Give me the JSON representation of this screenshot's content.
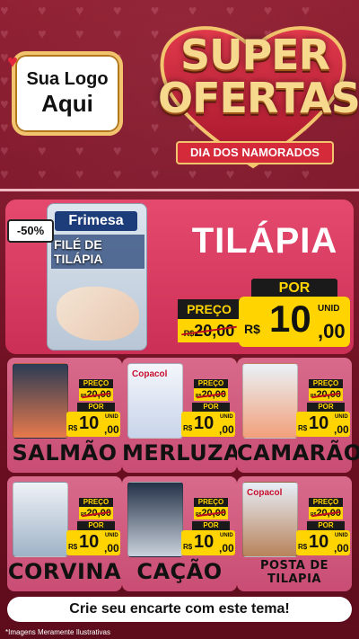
{
  "header": {
    "logo_line1": "Sua Logo",
    "logo_line2": "Aqui",
    "title_line1": "SUPER",
    "title_line2": "OFERTAS",
    "subtitle": "DIA DOS NAMORADOS"
  },
  "hero": {
    "discount": "-50%",
    "brand": "Frimesa",
    "pack_title": "FILÉ DE TILÁPIA",
    "name": "TILÁPIA",
    "preco_label": "PREÇO",
    "old_currency": "R$",
    "old_price": "20,00",
    "por_label": "POR",
    "currency": "R$",
    "price_int": "10",
    "price_cents": ",00",
    "unit": "UNID"
  },
  "cards": [
    {
      "name": "SALMÃO",
      "preco_label": "PREÇO",
      "old_currency": "R$",
      "old_price": "20,00",
      "por_label": "POR",
      "currency": "R$",
      "price_int": "10",
      "price_cents": ",00",
      "unit": "UNID",
      "img_color_top": "#2b3b55",
      "img_color_bottom": "#e87a4c"
    },
    {
      "name": "MERLUZA",
      "preco_label": "PREÇO",
      "old_currency": "R$",
      "old_price": "20,00",
      "por_label": "POR",
      "currency": "R$",
      "price_int": "10",
      "price_cents": ",00",
      "unit": "UNID",
      "img_color_top": "#f4f6fb",
      "img_color_bottom": "#c8d4ea",
      "brand": "Copacol"
    },
    {
      "name": "CAMARÃO",
      "preco_label": "PREÇO",
      "old_currency": "R$",
      "old_price": "20,00",
      "por_label": "POR",
      "currency": "R$",
      "price_int": "10",
      "price_cents": ",00",
      "unit": "UNID",
      "img_color_top": "#e9f1f7",
      "img_color_bottom": "#f2a07a"
    },
    {
      "name": "CORVINA",
      "preco_label": "PREÇO",
      "old_currency": "R$",
      "old_price": "20,00",
      "por_label": "POR",
      "currency": "R$",
      "price_int": "10",
      "price_cents": ",00",
      "unit": "UNID",
      "img_color_top": "#eef2f6",
      "img_color_bottom": "#9fb3c7"
    },
    {
      "name": "CAÇÃO",
      "preco_label": "PREÇO",
      "old_currency": "R$",
      "old_price": "20,00",
      "por_label": "POR",
      "currency": "R$",
      "price_int": "10",
      "price_cents": ",00",
      "unit": "UNID",
      "img_color_top": "#243248",
      "img_color_bottom": "#c9d2dc"
    },
    {
      "name": "POSTA DE TILAPIA",
      "preco_label": "PREÇO",
      "old_currency": "R$",
      "old_price": "20,00",
      "por_label": "POR",
      "currency": "R$",
      "price_int": "10",
      "price_cents": ",00",
      "unit": "UNID",
      "img_color_top": "#e7eef8",
      "img_color_bottom": "#b8835a",
      "brand": "Copacol"
    }
  ],
  "cta": "Crie seu encarte com este tema!",
  "disclaimer": "*Imagens Meramente Ilustrativas",
  "colors": {
    "background": "#7a1426",
    "hero_card": "#d63a60",
    "grid_card": "#cf5a7e",
    "price_yellow": "#ffd400",
    "label_black": "#1a1a1a",
    "accent_gold": "#f2c46d",
    "heart_red": "#e1283c"
  }
}
